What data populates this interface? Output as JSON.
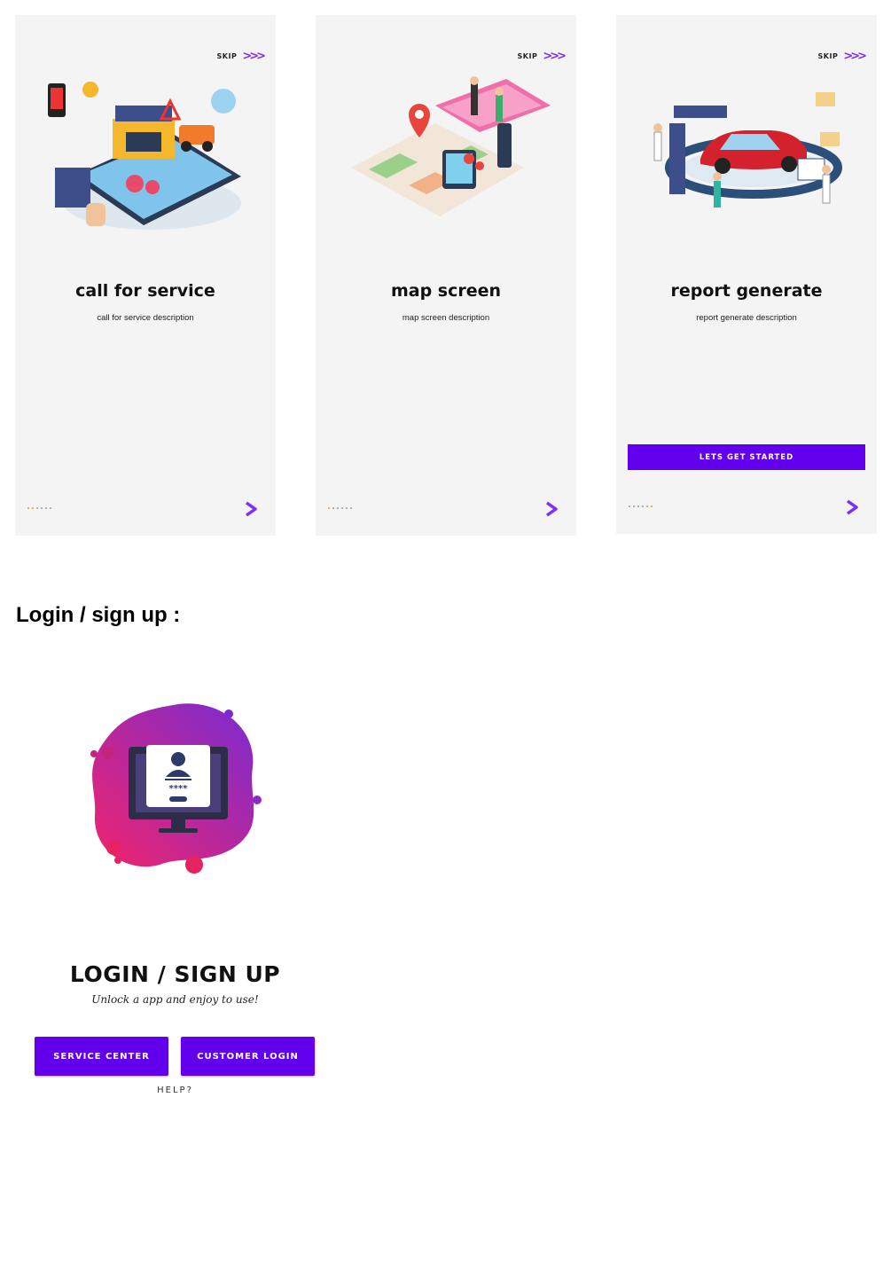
{
  "onboarding": [
    {
      "skip_label": "SKIP",
      "title": "call for service",
      "description": "call for service description",
      "illustration": "auto-service-illustration"
    },
    {
      "skip_label": "SKIP",
      "title": "map screen",
      "description": "map screen description",
      "illustration": "map-navigation-illustration"
    },
    {
      "skip_label": "SKIP",
      "title": "report generate",
      "description": "report generate description",
      "illustration": "car-diagnostics-illustration",
      "cta_label": "LETS GET STARTED"
    }
  ],
  "login_section": {
    "heading": "Login / sign up :",
    "title": "LOGIN / SIGN UP",
    "subtitle": "Unlock a app and enjoy to use!",
    "service_center_label": "SERVICE CENTER",
    "customer_login_label": "CUSTOMER LOGIN",
    "help_label": "HELP?",
    "illustration": "login-monitor-illustration"
  },
  "colors": {
    "accent": "#6200ee",
    "chevron": "#7b2ff7",
    "screen_bg": "#f4f4f4",
    "dot_active": "#e39b2a"
  }
}
